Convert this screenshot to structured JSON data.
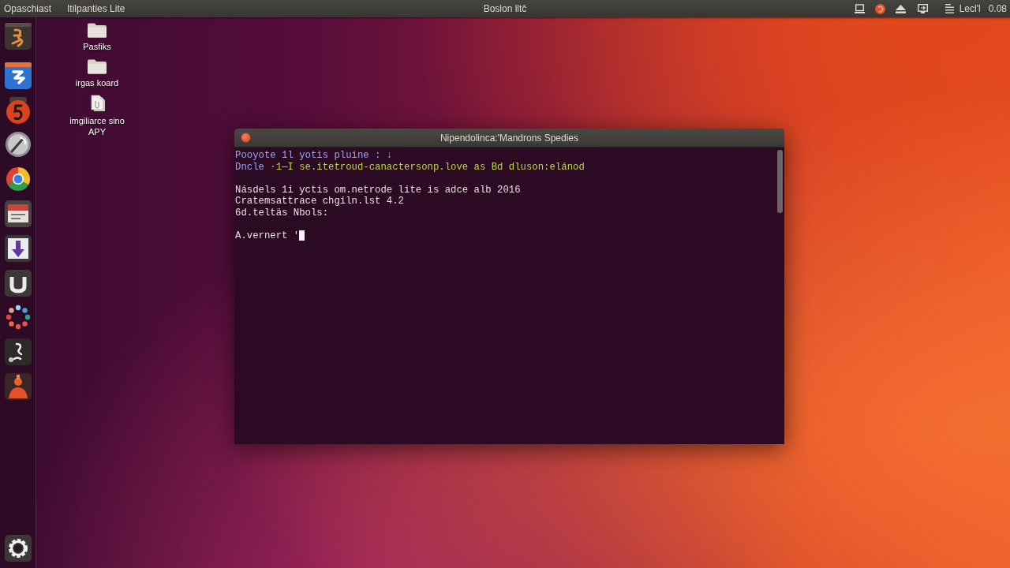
{
  "top_bar": {
    "menu_items": [
      "Opaschiast",
      "Itilpanties Lite"
    ],
    "title": "Boslon lltĉ",
    "indicator_label": "Lecl'l",
    "clock": "0.08"
  },
  "desktop_icons": [
    {
      "kind": "folder",
      "label": "Pasfiks"
    },
    {
      "kind": "folder",
      "label": "irgas koard"
    },
    {
      "kind": "file",
      "label": "imgiliarce sino APY"
    }
  ],
  "terminal": {
    "title": "Nipendolinca:'Mandrons Spedies",
    "output_blocks": [
      [
        {
          "segments": [
            {
              "text": "Pooyote 1l yotis pluine : ↓",
              "color": "#9aa6ee"
            }
          ],
          "cursor": false
        },
        {
          "segments": [
            {
              "text": "Dncle",
              "color": "#9aa6ee"
            },
            {
              "text": " ·1—I se.itetroud-canactersonp.love as Bd dluson:elánod",
              "color": "#b9d64c"
            }
          ],
          "cursor": false
        }
      ],
      [
        {
          "segments": [
            {
              "text": "Násdels 1i yctis om.netrode lite is adce alb 2016",
              "color": "#e6e2de"
            }
          ],
          "cursor": false
        },
        {
          "segments": [
            {
              "text": "Cratemsattrace chgiln.lst 4.2",
              "color": "#e6e2de"
            }
          ],
          "cursor": false
        },
        {
          "segments": [
            {
              "text": "6d.teltäs Nbols:",
              "color": "#e6e2de"
            }
          ],
          "cursor": false
        }
      ],
      [
        {
          "segments": [
            {
              "text": "A.vernert '",
              "color": "#e6e2de"
            }
          ],
          "cursor": true
        }
      ]
    ]
  }
}
